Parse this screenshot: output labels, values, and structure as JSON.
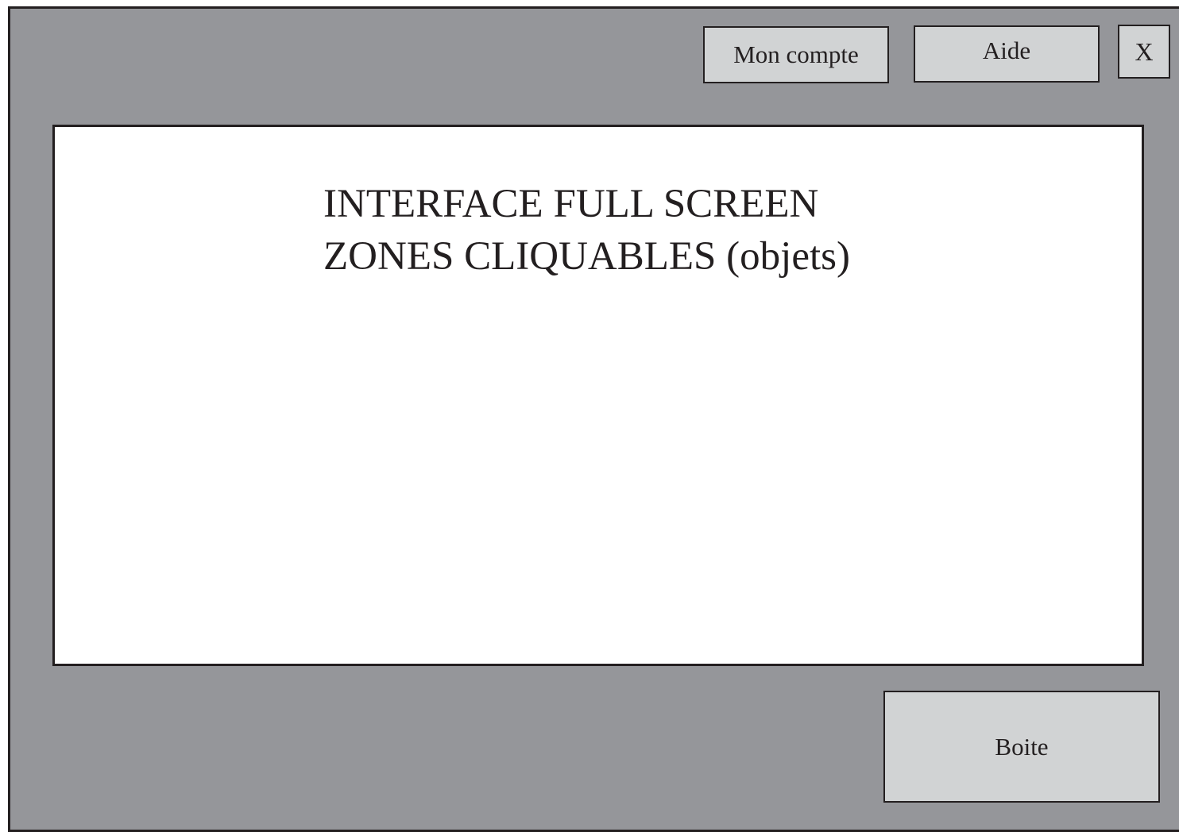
{
  "header": {
    "account_label": "Mon compte",
    "help_label": "Aide",
    "close_label": "X"
  },
  "main": {
    "title_line1": "INTERFACE FULL SCREEN",
    "title_line2": "ZONES CLIQUABLES (objets)"
  },
  "footer": {
    "box_label": "Boite"
  },
  "colors": {
    "background": "#95969a",
    "button": "#d1d3d4",
    "border": "#231f20",
    "screen": "#ffffff"
  }
}
